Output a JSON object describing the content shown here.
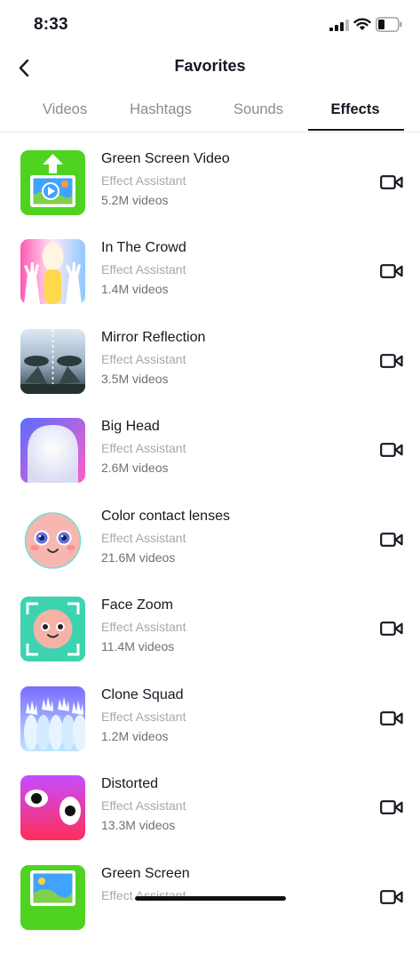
{
  "status_bar": {
    "time": "8:33"
  },
  "header": {
    "title": "Favorites"
  },
  "tabs": [
    {
      "label": "Videos"
    },
    {
      "label": "Hashtags"
    },
    {
      "label": "Sounds"
    },
    {
      "label": "Effects",
      "active": true
    }
  ],
  "effects": [
    {
      "name": "Green Screen Video",
      "author": "Effect Assistant",
      "count": "5.2M videos",
      "icon": "green-screen-video-thumbnail"
    },
    {
      "name": "In The Crowd",
      "author": "Effect Assistant",
      "count": "1.4M videos",
      "icon": "in-the-crowd-thumbnail"
    },
    {
      "name": "Mirror Reflection",
      "author": "Effect Assistant",
      "count": "3.5M videos",
      "icon": "mirror-reflection-thumbnail"
    },
    {
      "name": "Big Head",
      "author": "Effect Assistant",
      "count": "2.6M videos",
      "icon": "big-head-thumbnail"
    },
    {
      "name": "Color contact lenses",
      "author": "Effect Assistant",
      "count": "21.6M videos",
      "icon": "color-contact-lenses-thumbnail"
    },
    {
      "name": "Face Zoom",
      "author": "Effect Assistant",
      "count": "11.4M videos",
      "icon": "face-zoom-thumbnail"
    },
    {
      "name": "Clone Squad",
      "author": "Effect Assistant",
      "count": "1.2M videos",
      "icon": "clone-squad-thumbnail"
    },
    {
      "name": "Distorted",
      "author": "Effect Assistant",
      "count": "13.3M videos",
      "icon": "distorted-thumbnail"
    },
    {
      "name": "Green Screen",
      "author": "Effect Assistant",
      "count": "",
      "icon": "green-screen-thumbnail"
    }
  ],
  "colors": {
    "text": "#161823",
    "muted": "#a7a8ad",
    "tab_inactive": "#8a8b91"
  }
}
